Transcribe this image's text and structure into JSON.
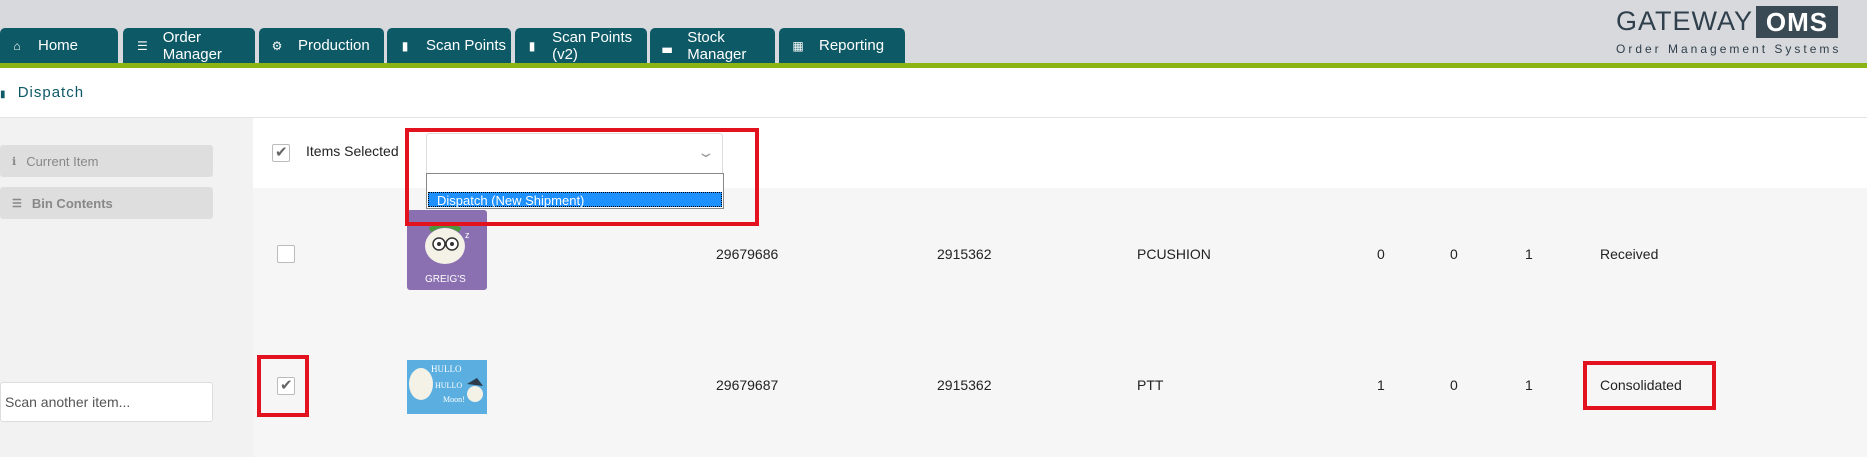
{
  "nav": {
    "tabs": [
      {
        "label": "Home",
        "icon": "home-icon"
      },
      {
        "label": "Order Manager",
        "icon": "list-icon"
      },
      {
        "label": "Production",
        "icon": "gears-icon"
      },
      {
        "label": "Scan Points",
        "icon": "barcode-icon"
      },
      {
        "label": "Scan Points (v2)",
        "icon": "barcode-icon"
      },
      {
        "label": "Stock Manager",
        "icon": "chart-icon"
      },
      {
        "label": "Reporting",
        "icon": "table-icon"
      }
    ]
  },
  "logo": {
    "gateway": "GATEWAY",
    "oms": "OMS",
    "tagline": "Order Management Systems"
  },
  "breadcrumb": {
    "label": "Dispatch",
    "icon": "truck-icon"
  },
  "sidebar": {
    "current_item": "Current Item",
    "bin_contents": "Bin Contents",
    "scan_placeholder": "Scan another item..."
  },
  "toolbar": {
    "items_selected_label": "Items Selected",
    "items_selected_checked": true,
    "action_select_value": "",
    "dropdown_options": [
      "",
      "Dispatch (New Shipment)"
    ],
    "highlighted_option": "Dispatch (New Shipment)"
  },
  "rows": [
    {
      "checked": false,
      "image": "purple-cushion-thumbnail",
      "thumbnail_text": "GREIG'S",
      "item_id": "29679686",
      "order_id": "2915362",
      "sku": "PCUSHION",
      "qty_a": "0",
      "qty_b": "0",
      "qty_c": "1",
      "status": "Received"
    },
    {
      "checked": true,
      "image": "blue-tea-towel-thumbnail",
      "thumbnail_text": [
        "HULLO",
        "HULLO",
        "Moon!"
      ],
      "item_id": "29679687",
      "order_id": "2915362",
      "sku": "PTT",
      "qty_a": "1",
      "qty_b": "0",
      "qty_c": "1",
      "status": "Consolidated"
    }
  ],
  "colors": {
    "nav_bg": "#0d5966",
    "accent": "#8ab514",
    "highlight": "#e2131f",
    "selected_option": "#1e90ff"
  }
}
